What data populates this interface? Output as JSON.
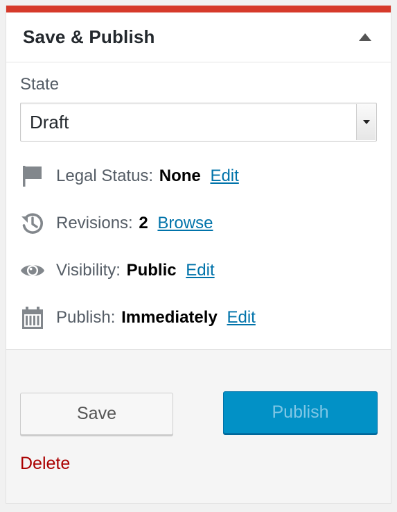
{
  "header": {
    "title": "Save & Publish"
  },
  "state": {
    "label": "State",
    "selected": "Draft"
  },
  "rows": [
    {
      "icon": "flag-icon",
      "label": "Legal Status:",
      "value": "None",
      "link": "Edit"
    },
    {
      "icon": "history-icon",
      "label": "Revisions:",
      "value": "2",
      "link": "Browse"
    },
    {
      "icon": "eye-icon",
      "label": "Visibility:",
      "value": "Public",
      "link": "Edit"
    },
    {
      "icon": "calendar-icon",
      "label": "Publish:",
      "value": "Immediately",
      "link": "Edit"
    }
  ],
  "actions": {
    "save_label": "Save",
    "publish_label": "Publish",
    "delete_label": "Delete"
  },
  "colors": {
    "accent_bar": "#d63a2b",
    "link": "#0073aa",
    "publish_button": "#0291c6",
    "delete": "#aa0000"
  }
}
